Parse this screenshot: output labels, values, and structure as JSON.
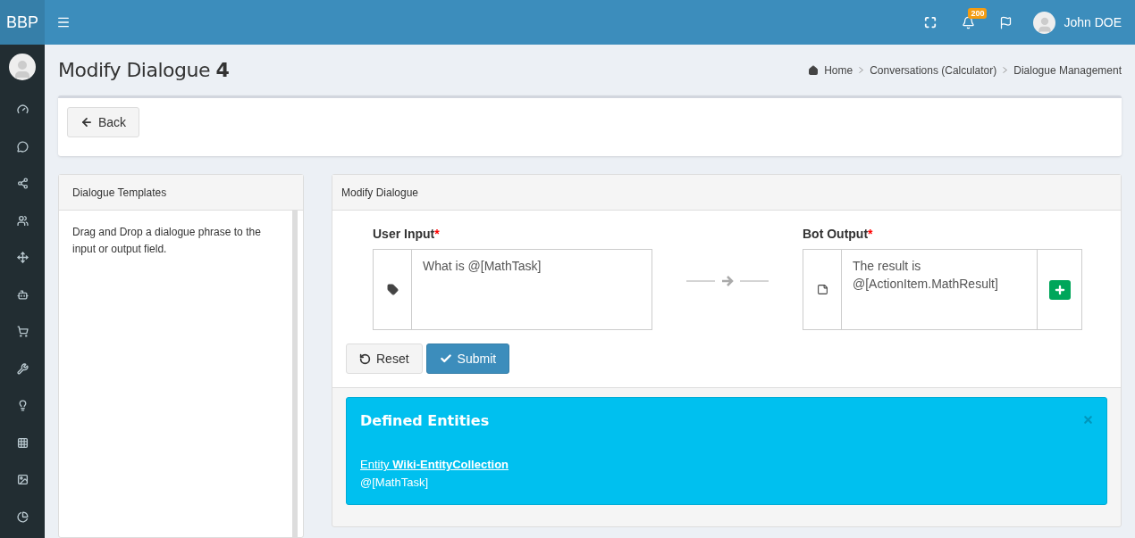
{
  "brand": "BBP",
  "topbar": {
    "notification_count": "200",
    "user_name": "John DOE"
  },
  "sidebar": {
    "items": [
      {
        "kind": "dashboard"
      },
      {
        "kind": "chat"
      },
      {
        "kind": "share"
      },
      {
        "kind": "users"
      },
      {
        "kind": "move"
      },
      {
        "kind": "android"
      },
      {
        "kind": "cart"
      },
      {
        "kind": "wrench"
      },
      {
        "kind": "bulb"
      },
      {
        "kind": "grid"
      },
      {
        "kind": "image"
      },
      {
        "kind": "pie"
      }
    ]
  },
  "page": {
    "title": "Modify Dialogue",
    "title_number": "4"
  },
  "breadcrumb": [
    "Home",
    "Conversations (Calculator)",
    "Dialogue Management"
  ],
  "back_button": "Back",
  "templates_panel": {
    "title": "Dialogue Templates",
    "text": "Drag and Drop a dialogue phrase to the input or output field."
  },
  "modify_panel": {
    "title": "Modify Dialogue",
    "user_input": {
      "label": "User Input",
      "required_mark": "*",
      "value": "What is @[MathTask]"
    },
    "bot_output": {
      "label": "Bot Output",
      "required_mark": "*",
      "value": "The result is @[ActionItem.MathResult]"
    },
    "buttons": [
      {
        "kind": "reset",
        "label": "Reset"
      },
      {
        "kind": "submit",
        "label": "Submit"
      }
    ]
  },
  "entities_alert": {
    "title": "Defined Entities",
    "link": "Entity **Wiki-EntityCollection**",
    "value": "@[MathTask]"
  }
}
